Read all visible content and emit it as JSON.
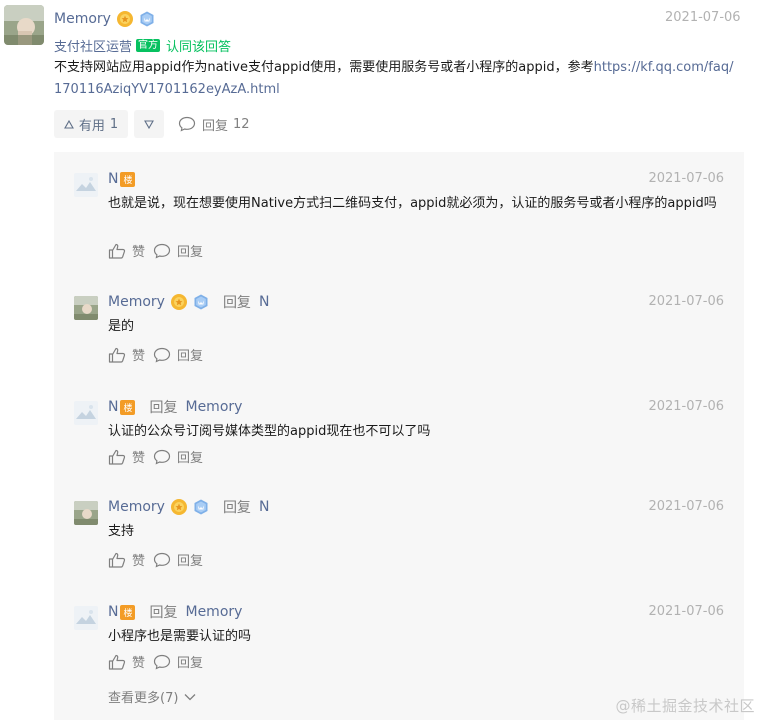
{
  "answer": {
    "author": "Memory",
    "date": "2021-07-06",
    "role_label": "支付社区运营",
    "official_badge": "官方",
    "approve_label": "认同该回答",
    "content_text": "不支持网站应用appid作为native支付appid使用，需要使用服务号或者小程序的appid，参考",
    "content_link": "https://kf.qq.com/faq/170116AziqYV1701162eyAzA.html",
    "upvote_label": "有用",
    "upvote_count": "1",
    "reply_label": "回复",
    "reply_count": "12"
  },
  "replies": [
    {
      "author": "N",
      "floor_badge": "楼",
      "reply_to": "",
      "date": "2021-07-06",
      "content": "也就是说，现在想要使用Native方式扫二维码支付，appid就必须为，认证的服务号或者小程序的appid吗",
      "like_label": "赞",
      "reply_label": "回复"
    },
    {
      "author": "Memory",
      "reply_word": "回复",
      "reply_to": "N",
      "date": "2021-07-06",
      "content": "是的",
      "like_label": "赞",
      "reply_label": "回复"
    },
    {
      "author": "N",
      "floor_badge": "楼",
      "reply_word": "回复",
      "reply_to": "Memory",
      "date": "2021-07-06",
      "content": "认证的公众号订阅号媒体类型的appid现在也不可以了吗",
      "like_label": "赞",
      "reply_label": "回复"
    },
    {
      "author": "Memory",
      "reply_word": "回复",
      "reply_to": "N",
      "date": "2021-07-06",
      "content": "支持",
      "like_label": "赞",
      "reply_label": "回复"
    },
    {
      "author": "N",
      "floor_badge": "楼",
      "reply_word": "回复",
      "reply_to": "Memory",
      "date": "2021-07-06",
      "content": "小程序也是需要认证的吗",
      "like_label": "赞",
      "reply_label": "回复"
    }
  ],
  "see_more_label": "查看更多(7)",
  "watermark": "@稀土掘金技术社区",
  "colors": {
    "link": "#576b95",
    "official_green": "#07c160",
    "floor_badge": "#f39c26",
    "panel_bg": "#f7f7f7"
  },
  "icons": [
    "gold-medal-icon",
    "shield-badge-icon",
    "triangle-up-icon",
    "triangle-down-icon",
    "comment-bubble-icon",
    "thumbs-up-icon",
    "chevron-down-icon"
  ]
}
